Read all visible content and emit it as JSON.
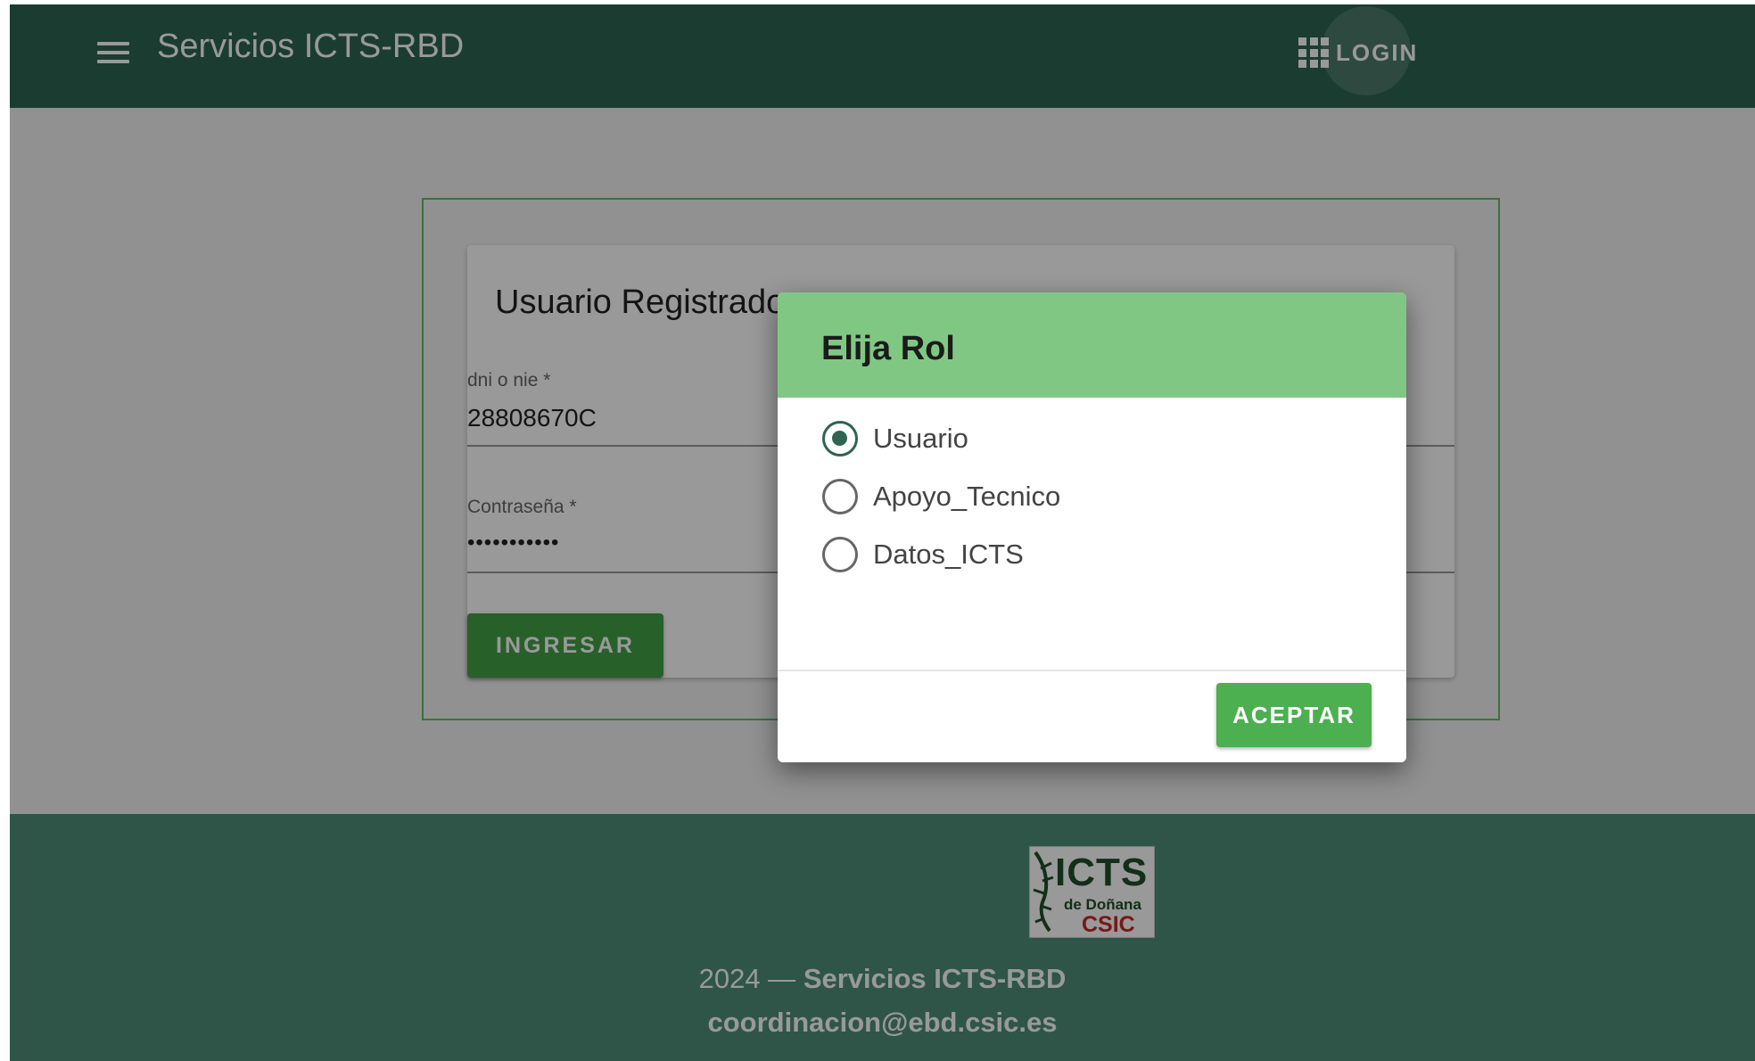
{
  "header": {
    "title": "Servicios ICTS-RBD",
    "login_label": "LOGIN",
    "menu_icon": "hamburger-menu-icon",
    "apps_icon": "apps-grid-icon"
  },
  "login_card": {
    "title": "Usuario Registrado",
    "dni": {
      "label": "dni o nie *",
      "value": "28808670C"
    },
    "password": {
      "label": "Contraseña *",
      "value": "•••••••••••"
    },
    "submit_label": "INGRESAR"
  },
  "footer": {
    "logo": {
      "icts": "ICTS",
      "donana": "de Doñana",
      "csic": "CSIC"
    },
    "year": "2024 —",
    "name": "Servicios ICTS-RBD",
    "email": "coordinacion@ebd.csic.es"
  },
  "dialog": {
    "title": "Elija Rol",
    "options": [
      {
        "label": "Usuario",
        "checked": true
      },
      {
        "label": "Apoyo_Tecnico",
        "checked": false
      },
      {
        "label": "Datos_ICTS",
        "checked": false
      }
    ],
    "accept_label": "ACEPTAR"
  },
  "colors": {
    "header_bg": "#2e6451",
    "footer_bg": "#4e8e78",
    "dialog_header_bg": "#81c784",
    "primary_button": "#4caf50",
    "radio_selected": "#2e6451"
  }
}
